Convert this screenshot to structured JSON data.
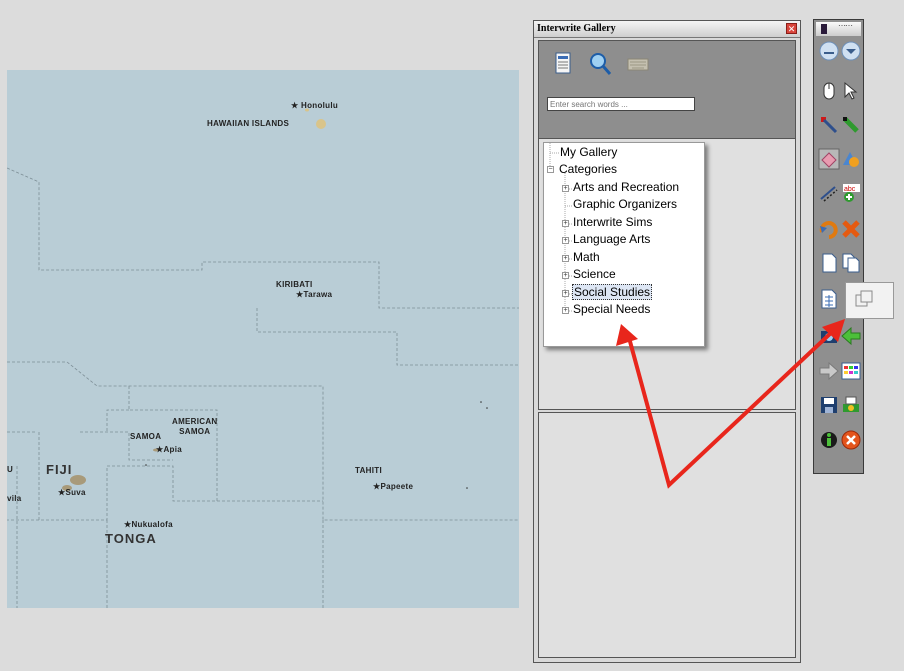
{
  "map": {
    "labels": {
      "honolulu": "★ Honolulu",
      "hawaiian_islands": "HAWAIIAN  ISLANDS",
      "kiribati": "KIRIBATI",
      "tarawa": "★Tarawa",
      "american_samoa": "AMERICAN\nSAMOA",
      "samoa": "SAMOA",
      "apia": "★Apia",
      "fiji": "FIJI",
      "suva": "★Suva",
      "vila": "vila",
      "u": "U",
      "tahiti": "TAHITI",
      "papeete": "★Papeete",
      "nukualofa": "★Nukualofa",
      "tonga": "TONGA"
    }
  },
  "gallery": {
    "title": "Interwrite Gallery",
    "close_glyph": "✕",
    "search": {
      "placeholder": "Enter search words ...",
      "value": ""
    },
    "tree": {
      "my_gallery": "My Gallery",
      "categories": "Categories",
      "categories_expander": "−",
      "items": [
        {
          "label": "Arts and Recreation",
          "expander": "+"
        },
        {
          "label": "Graphic Organizers",
          "expander": ""
        },
        {
          "label": "Interwrite Sims",
          "expander": "+"
        },
        {
          "label": "Language Arts",
          "expander": "+"
        },
        {
          "label": "Math",
          "expander": "+"
        },
        {
          "label": "Science",
          "expander": "+"
        },
        {
          "label": "Social Studies",
          "expander": "+",
          "selected": true
        },
        {
          "label": "Special Needs",
          "expander": "+"
        }
      ]
    }
  },
  "toolbar": {
    "grip": "⋯⋯"
  },
  "colors": {
    "map_water": "#b9cdd6",
    "arrow": "#e8261c",
    "panel_gray": "#8e8e8e"
  }
}
